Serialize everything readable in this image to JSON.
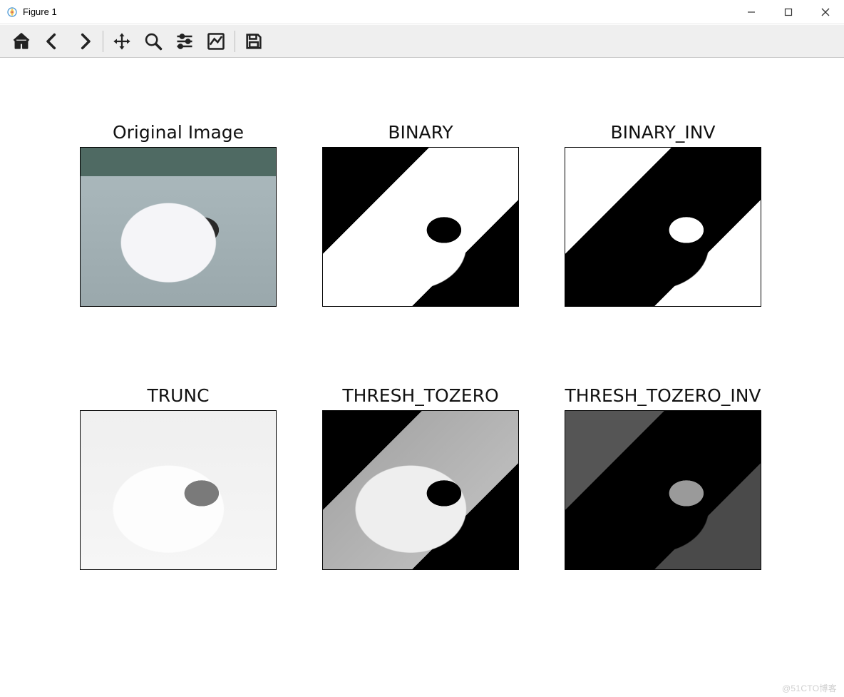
{
  "window": {
    "title": "Figure 1"
  },
  "toolbar": {
    "home": "Home",
    "back": "Back",
    "forward": "Forward",
    "pan": "Pan",
    "zoom": "Zoom",
    "subplots": "Configure subplots",
    "axes": "Edit axes",
    "save": "Save"
  },
  "subplots": [
    {
      "title": "Original Image",
      "kind": "original"
    },
    {
      "title": "BINARY",
      "kind": "binary"
    },
    {
      "title": "BINARY_INV",
      "kind": "binary_inv"
    },
    {
      "title": "TRUNC",
      "kind": "trunc"
    },
    {
      "title": "THRESH_TOZERO",
      "kind": "tozero"
    },
    {
      "title": "THRESH_TOZERO_INV",
      "kind": "tozero_inv"
    }
  ],
  "watermark": "@51CTO博客"
}
